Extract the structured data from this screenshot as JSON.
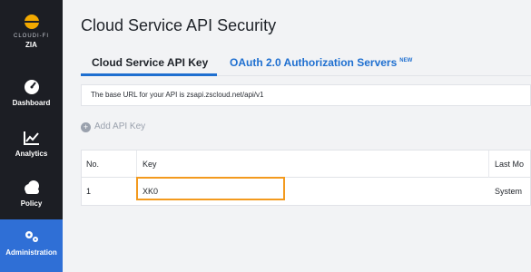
{
  "sidebar": {
    "brand_name": "CLOUDI-FI",
    "brand_sub": "ZIA",
    "items": [
      {
        "label": "Dashboard",
        "icon": "dashboard-gauge-icon"
      },
      {
        "label": "Analytics",
        "icon": "line-chart-icon"
      },
      {
        "label": "Policy",
        "icon": "cloud-icon"
      },
      {
        "label": "Administration",
        "icon": "gears-icon",
        "active": true
      }
    ]
  },
  "page": {
    "title": "Cloud Service API Security"
  },
  "tabs": [
    {
      "label": "Cloud Service API Key",
      "active": true
    },
    {
      "label": "OAuth 2.0 Authorization Servers",
      "badge": "NEW"
    }
  ],
  "info": {
    "text": "The base URL for your API is zsapi.zscloud.net/api/v1"
  },
  "actions": {
    "add_key": "Add API Key"
  },
  "table": {
    "columns": [
      "No.",
      "Key",
      "Last Mo"
    ],
    "rows": [
      {
        "no": "1",
        "key": "XK0",
        "last": "System"
      }
    ]
  },
  "colors": {
    "sidebar": "#1c1e24",
    "active_nav": "#2f6fd6",
    "accent": "#1e6fd0",
    "highlight": "#f39a1e"
  }
}
